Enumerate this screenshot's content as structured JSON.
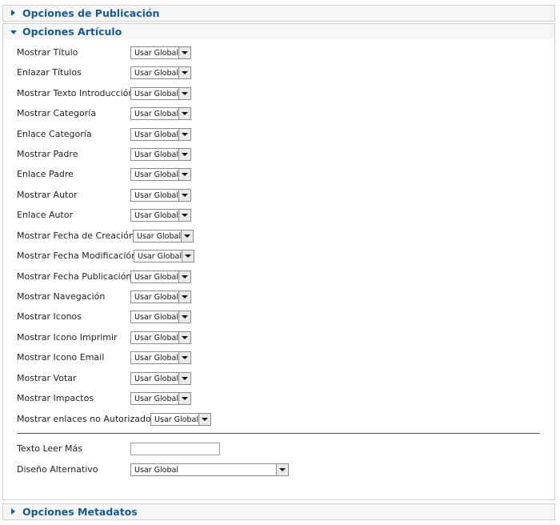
{
  "sections": {
    "publicacion": {
      "title": "Opciones de Publicación",
      "state": "collapsed"
    },
    "articulo": {
      "title": "Opciones Artículo",
      "state": "expanded"
    },
    "metadatos": {
      "title": "Opciones Metadatos",
      "state": "collapsed"
    }
  },
  "options": [
    {
      "label": "Mostrar Título",
      "value": "Usar Global"
    },
    {
      "label": "Enlazar Títulos",
      "value": "Usar Global"
    },
    {
      "label": "Mostrar Texto Introducción",
      "value": "Usar Global"
    },
    {
      "label": "Mostrar Categoría",
      "value": "Usar Global"
    },
    {
      "label": "Enlace Categoría",
      "value": "Usar Global"
    },
    {
      "label": "Mostrar Padre",
      "value": "Usar Global"
    },
    {
      "label": "Enlace Padre",
      "value": "Usar Global"
    },
    {
      "label": "Mostrar Autor",
      "value": "Usar Global"
    },
    {
      "label": "Enlace Autor",
      "value": "Usar Global"
    },
    {
      "label": "Mostrar Fecha de Creación",
      "value": "Usar Global"
    },
    {
      "label": "Mostrar Fecha Modificación",
      "value": "Usar Global"
    },
    {
      "label": "Mostrar Fecha Publicación",
      "value": "Usar Global"
    },
    {
      "label": "Mostrar Navegación",
      "value": "Usar Global"
    },
    {
      "label": "Mostrar Iconos",
      "value": "Usar Global"
    },
    {
      "label": "Mostrar Icono Imprimir",
      "value": "Usar Global"
    },
    {
      "label": "Mostrar Icono Email",
      "value": "Usar Global"
    },
    {
      "label": "Mostrar Votar",
      "value": "Usar Global"
    },
    {
      "label": "Mostrar Impactos",
      "value": "Usar Global"
    },
    {
      "label": "Mostrar enlaces no Autorizados",
      "value": "Usar Global"
    }
  ],
  "leer_mas": {
    "label": "Texto Leer Más",
    "value": ""
  },
  "diseno": {
    "label": "Diseño Alternativo",
    "value": "Usar Global"
  },
  "icons": {
    "collapsed": "triangle-right-icon",
    "expanded": "triangle-down-icon",
    "dropdown": "chevron-down-icon"
  },
  "colors": {
    "header_text": "#155a96",
    "arrow": "#0b61a4",
    "header_bg": "#f6f6f6"
  }
}
